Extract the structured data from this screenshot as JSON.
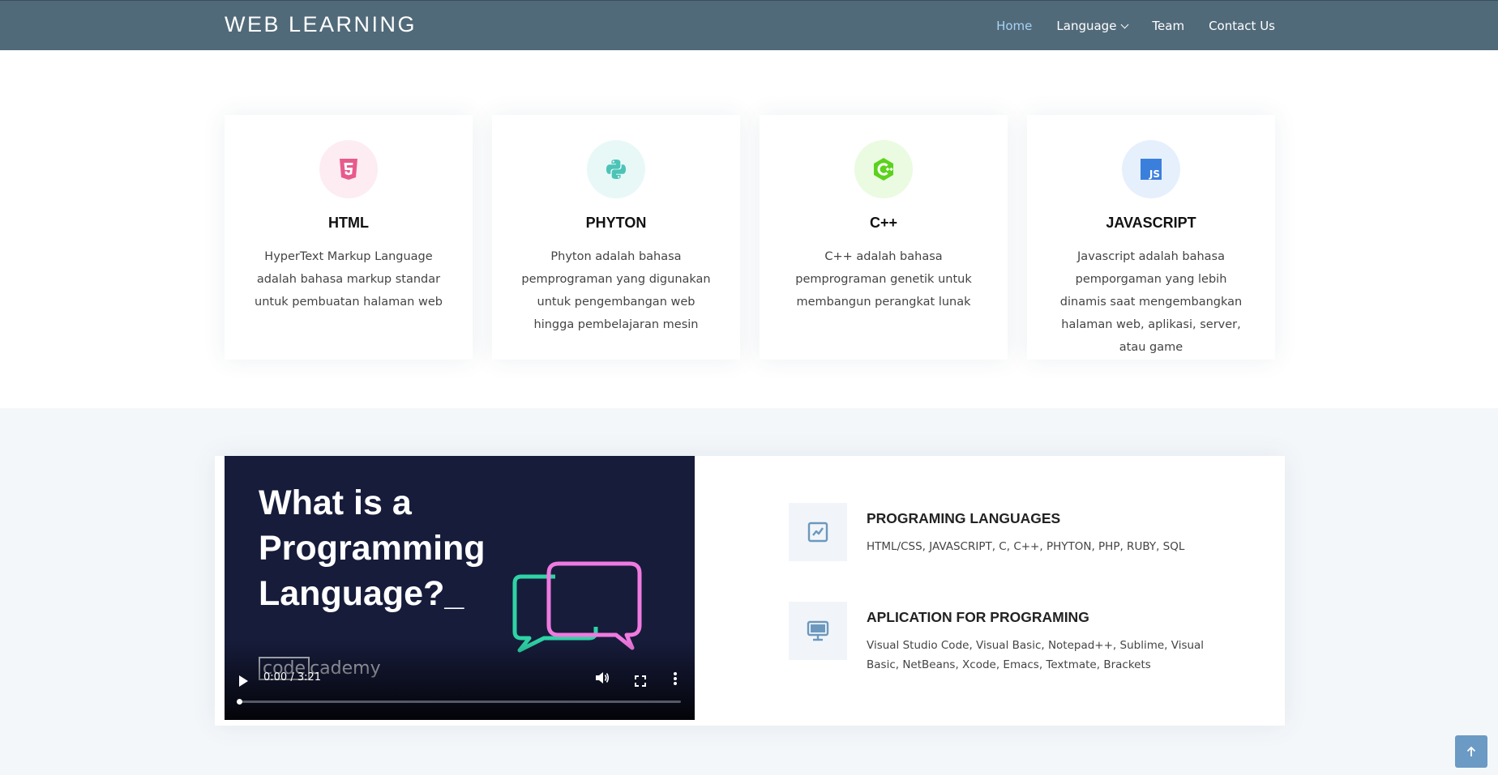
{
  "header": {
    "logo": "WEB LEARNING",
    "nav": [
      {
        "label": "Home",
        "active": true
      },
      {
        "label": "Language",
        "dropdown": true
      },
      {
        "label": "Team"
      },
      {
        "label": "Contact Us"
      }
    ]
  },
  "cards": [
    {
      "icon": "html5-icon",
      "icon_color": "#e85a8c",
      "icon_bg": "#fdecf2",
      "title": "HTML",
      "desc": "HyperText Markup Language adalah bahasa markup standar untuk pembuatan halaman web"
    },
    {
      "icon": "python-icon",
      "icon_color": "#4cc3b7",
      "icon_bg": "#e8f8f7",
      "title": "PHYTON",
      "desc": "Phyton adalah bahasa pemprograman yang digunakan untuk pengembangan web hingga pembelajaran mesin"
    },
    {
      "icon": "cplusplus-icon",
      "icon_color": "#5bd21c",
      "icon_bg": "#eafbe2",
      "title": "C++",
      "desc": "C++ adalah bahasa pemprograman genetik untuk membangun perangkat lunak"
    },
    {
      "icon": "javascript-icon",
      "icon_color": "#3b7fdd",
      "icon_bg": "#e6f0fd",
      "title": "JAVASCRIPT",
      "desc": "Javascript adalah bahasa pemporgaman yang lebih dinamis saat mengembangkan halaman web, aplikasi, server, atau game"
    }
  ],
  "video": {
    "title": "What is a Programming Language?_",
    "brand_code": "code",
    "brand_rest": "cademy",
    "time": "0:00 / 3:21",
    "progress": 0.0
  },
  "features": [
    {
      "icon": "chart-icon",
      "title": "PROGRAMING LANGUAGES",
      "text": "HTML/CSS, JAVASCRIPT, C, C++, PHYTON, PHP, RUBY, SQL"
    },
    {
      "icon": "monitor-icon",
      "title": "APLICATION FOR PROGRAMING",
      "text": "Visual Studio Code, Visual Basic, Notepad++, Sublime, Visual Basic, NetBeans, Xcode, Emacs, Textmate, Brackets"
    }
  ],
  "colors": {
    "header_bg": "#516a79",
    "nav_active": "#a7d3f5",
    "section_bg": "#f4f7fa",
    "back_to_top": "#6b9ac4"
  }
}
